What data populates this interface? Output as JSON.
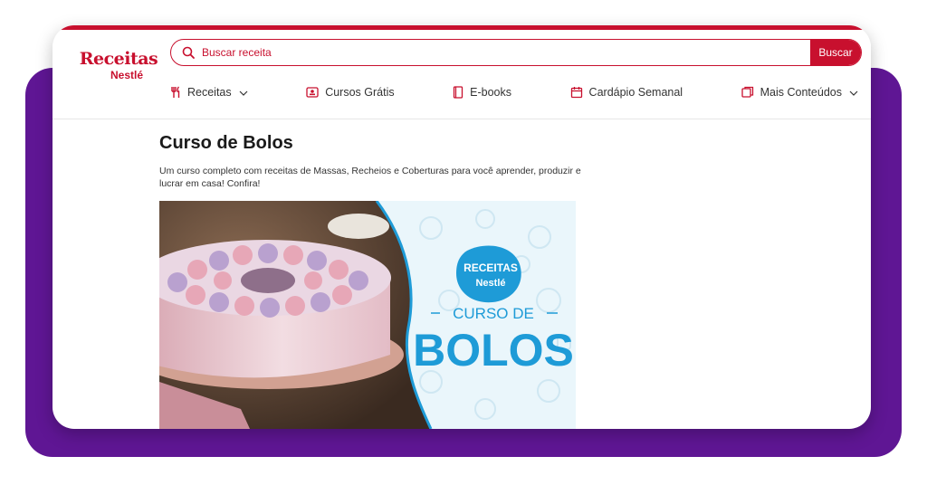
{
  "logo": {
    "main": "Receitas",
    "sub": "Nestlé"
  },
  "search": {
    "placeholder": "Buscar receita",
    "button_label": "Buscar"
  },
  "nav": [
    {
      "label": "Receitas",
      "icon": "utensils-icon",
      "dropdown": true
    },
    {
      "label": "Cursos Grátis",
      "icon": "video-icon",
      "dropdown": false
    },
    {
      "label": "E-books",
      "icon": "book-icon",
      "dropdown": false
    },
    {
      "label": "Cardápio Semanal",
      "icon": "calendar-icon",
      "dropdown": false
    },
    {
      "label": "Mais Conteúdos",
      "icon": "content-icon",
      "dropdown": true
    }
  ],
  "page": {
    "title": "Curso de Bolos",
    "description": "Um curso completo com receitas de Massas, Recheios e Coberturas para você aprender, produzir e lucrar em casa! Confira!"
  },
  "hero": {
    "badge_line1": "RECEITAS",
    "badge_line2": "Nestlé",
    "course_label": "CURSO DE",
    "course_name": "BOLOS"
  },
  "colors": {
    "brand_red": "#c8102e",
    "frame_purple": "#5f1694",
    "hero_blue": "#1e9bd7"
  }
}
